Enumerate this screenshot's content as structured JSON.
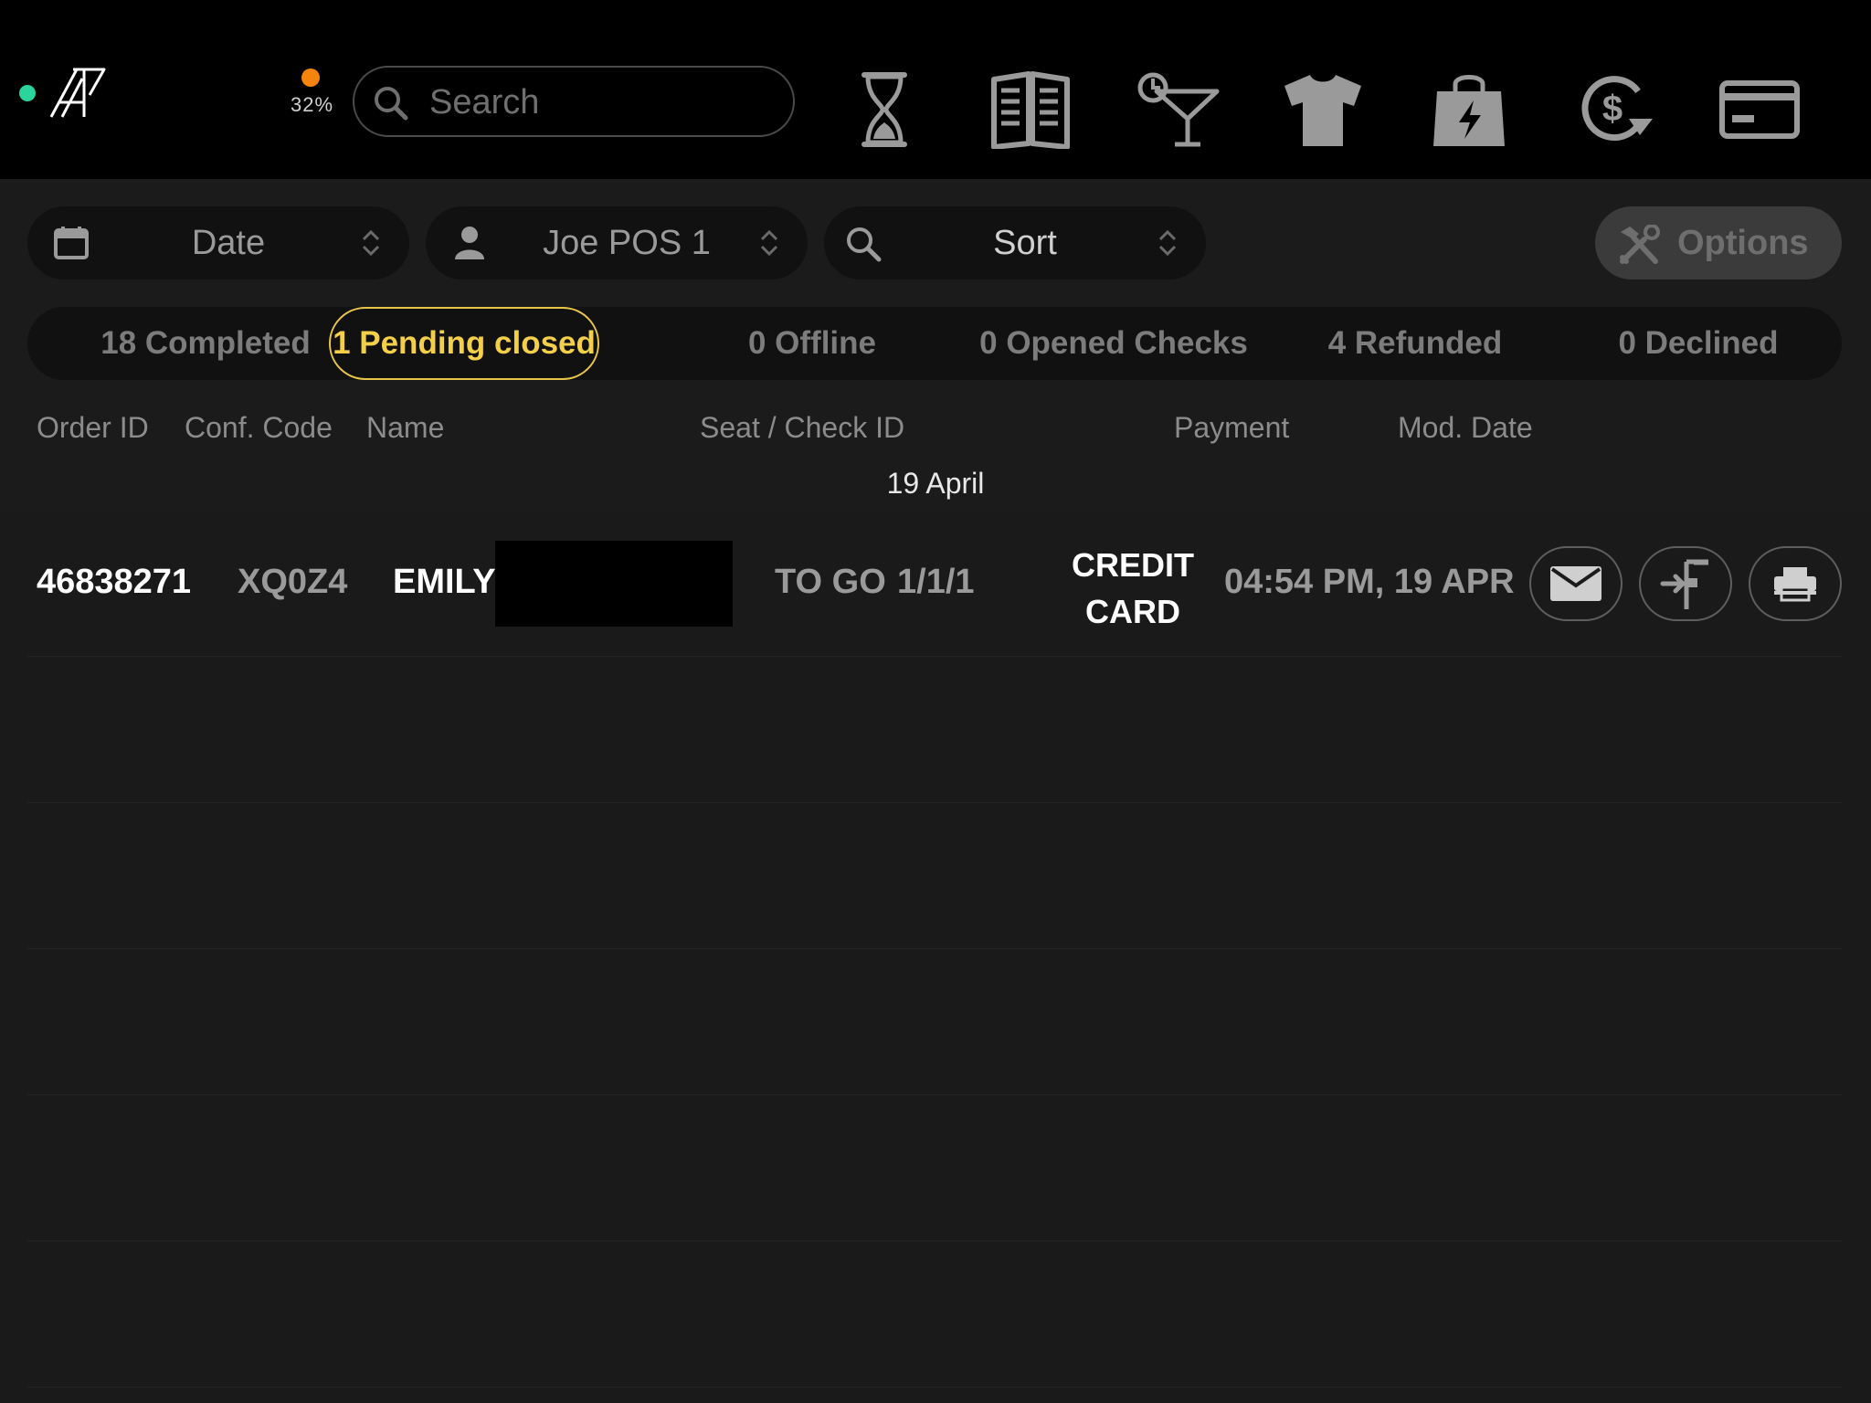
{
  "header": {
    "battery_percent": "32%",
    "search_placeholder": "Search",
    "nav_icons": [
      "hourglass-icon",
      "menu-book-icon",
      "cocktail-icon",
      "tshirt-icon",
      "shopping-bag-icon",
      "refund-dollar-icon",
      "credit-card-icon"
    ]
  },
  "filters": {
    "date_label": "Date",
    "employee_label": "Joe POS 1",
    "sort_label": "Sort",
    "options_label": "Options"
  },
  "tabs": [
    {
      "label": "18 Completed",
      "active": false
    },
    {
      "label": "1 Pending closed",
      "active": true
    },
    {
      "label": "0 Offline",
      "active": false
    },
    {
      "label": "0 Opened Checks",
      "active": false
    },
    {
      "label": "4 Refunded",
      "active": false
    },
    {
      "label": "0 Declined",
      "active": false
    }
  ],
  "columns": {
    "order_id": "Order ID",
    "conf_code": "Conf. Code",
    "name": "Name",
    "seat_check": "Seat / Check ID",
    "payment": "Payment",
    "mod_date": "Mod. Date"
  },
  "date_group": "19 April",
  "orders": [
    {
      "order_id": "46838271",
      "conf_code": "XQ0Z4",
      "name": "EMILY",
      "type": "TO GO",
      "seat": "1/1/1",
      "payment_line1": "CREDIT",
      "payment_line2": "CARD",
      "mod_date": "04:54 PM, 19 APR",
      "actions": [
        "email-icon",
        "check-in-icon",
        "printer-icon"
      ]
    }
  ],
  "colors": {
    "accent_yellow": "#f3cf4a",
    "status_online": "#2bd49a",
    "battery_warning": "#f5840c"
  }
}
